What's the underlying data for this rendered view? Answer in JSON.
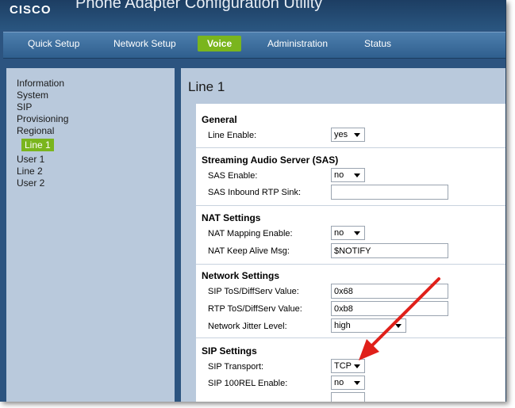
{
  "app": {
    "logo": "CISCO",
    "title": "Phone Adapter Configuration Utility"
  },
  "nav": {
    "tabs": [
      {
        "label": "Quick Setup"
      },
      {
        "label": "Network Setup"
      },
      {
        "label": "Voice",
        "active": true
      },
      {
        "label": "Administration"
      },
      {
        "label": "Status"
      }
    ]
  },
  "sidebar": {
    "items": [
      {
        "label": "Information"
      },
      {
        "label": "System"
      },
      {
        "label": "SIP"
      },
      {
        "label": "Provisioning"
      },
      {
        "label": "Regional"
      },
      {
        "label": "Line 1",
        "active": true
      },
      {
        "label": "User 1"
      },
      {
        "label": "Line 2"
      },
      {
        "label": "User 2"
      }
    ]
  },
  "main": {
    "title": "Line 1",
    "sections": {
      "general": {
        "title": "General",
        "line_enable": {
          "label": "Line Enable:",
          "value": "yes"
        }
      },
      "sas": {
        "title": "Streaming Audio Server (SAS)",
        "sas_enable": {
          "label": "SAS Enable:",
          "value": "no"
        },
        "sas_inbound": {
          "label": "SAS Inbound RTP Sink:",
          "value": ""
        }
      },
      "nat": {
        "title": "NAT Settings",
        "nat_mapping": {
          "label": "NAT Mapping Enable:",
          "value": "no"
        },
        "nat_keepalive": {
          "label": "NAT Keep Alive Msg:",
          "value": "$NOTIFY"
        }
      },
      "network": {
        "title": "Network Settings",
        "sip_tos": {
          "label": "SIP ToS/DiffServ Value:",
          "value": "0x68"
        },
        "rtp_tos": {
          "label": "RTP ToS/DiffServ Value:",
          "value": "0xb8"
        },
        "jitter": {
          "label": "Network Jitter Level:",
          "value": "high"
        }
      },
      "sip": {
        "title": "SIP Settings",
        "transport": {
          "label": "SIP Transport:",
          "value": "TCP"
        },
        "rel100": {
          "label": "SIP 100REL Enable:",
          "value": "no"
        }
      }
    }
  },
  "colors": {
    "header": "#2c5480",
    "accent": "#7ab51d",
    "panel": "#b9c9dc",
    "arrow": "#e0201a"
  }
}
